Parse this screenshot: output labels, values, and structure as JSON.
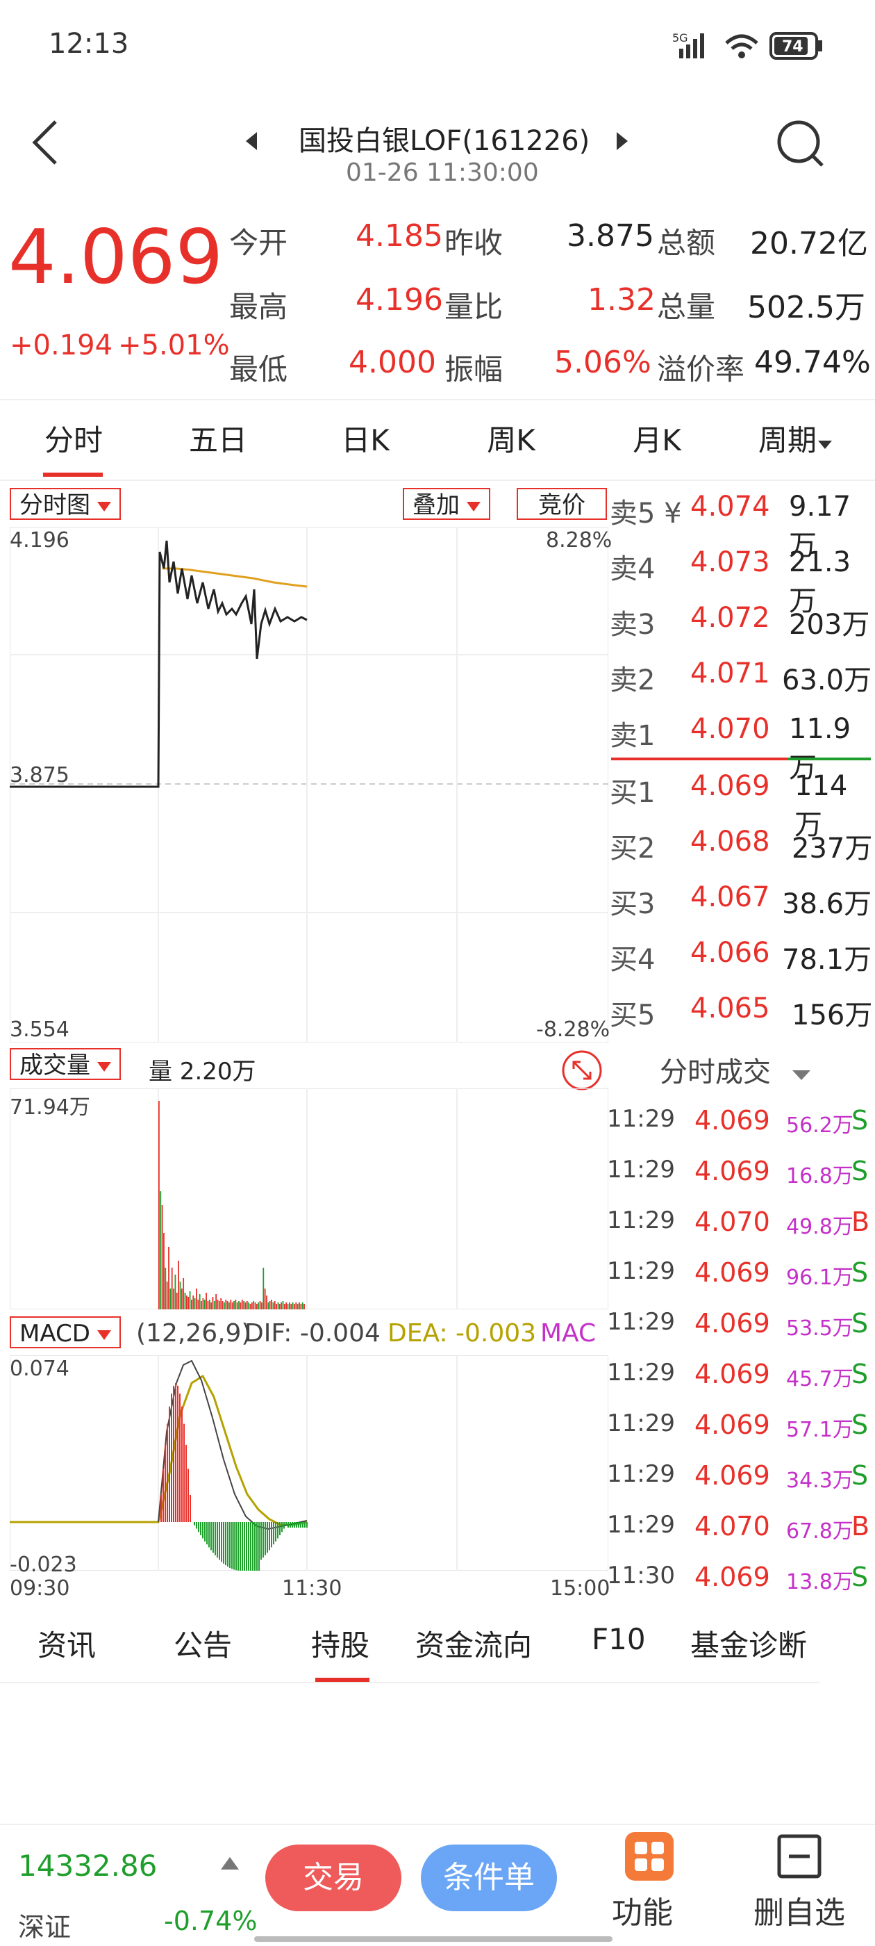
{
  "status": {
    "time": "12:13",
    "network": "5G",
    "battery": "74"
  },
  "header": {
    "title": "国投白银LOF(161226)",
    "subtitle": "01-26 11:30:00"
  },
  "quote": {
    "price": "4.069",
    "change": "+0.194",
    "change_pct": "+5.01%",
    "stats": [
      {
        "label": "今开",
        "value": "4.185"
      },
      {
        "label": "昨收",
        "value": "3.875"
      },
      {
        "label": "总额",
        "value": "20.72亿"
      },
      {
        "label": "最高",
        "value": "4.196"
      },
      {
        "label": "量比",
        "value": "1.32"
      },
      {
        "label": "总量",
        "value": "502.5万"
      },
      {
        "label": "最低",
        "value": "4.000"
      },
      {
        "label": "振幅",
        "value": "5.06%"
      },
      {
        "label": "溢价率",
        "value": "49.74%"
      }
    ]
  },
  "tabs": [
    "分时",
    "五日",
    "日K",
    "周K",
    "月K",
    "周期"
  ],
  "chart": {
    "selector": "分时图",
    "overlay": "叠加",
    "auction": "竞价",
    "y_top": "4.196",
    "y_mid": "3.875",
    "y_bot": "3.554",
    "pct_top": "8.28%",
    "pct_bot": "-8.28%",
    "volume_label": "成交量",
    "volume_value": "量 2.20万",
    "volume_max": "71.94万",
    "macd_label": "MACD",
    "macd_params": "(12,26,9)",
    "macd_dif": "DIF: -0.004",
    "macd_dea": "DEA: -0.003",
    "macd_mac": "MAC",
    "macd_top": "0.074",
    "macd_bot": "-0.023",
    "time_start": "09:30",
    "time_mid": "11:30",
    "time_end": "15:00"
  },
  "orderbook": {
    "asks": [
      {
        "label": "卖5 ¥",
        "price": "4.074",
        "vol": "9.17万"
      },
      {
        "label": "卖4",
        "price": "4.073",
        "vol": "21.3万"
      },
      {
        "label": "卖3",
        "price": "4.072",
        "vol": "203万"
      },
      {
        "label": "卖2",
        "price": "4.071",
        "vol": "63.0万"
      },
      {
        "label": "卖1",
        "price": "4.070",
        "vol": "11.9万"
      }
    ],
    "bids": [
      {
        "label": "买1",
        "price": "4.069",
        "vol": "114万"
      },
      {
        "label": "买2",
        "price": "4.068",
        "vol": "237万"
      },
      {
        "label": "买3",
        "price": "4.067",
        "vol": "38.6万"
      },
      {
        "label": "买4",
        "price": "4.066",
        "vol": "78.1万"
      },
      {
        "label": "买5",
        "price": "4.065",
        "vol": "156万"
      }
    ],
    "trades_title": "分时成交",
    "trades": [
      {
        "time": "11:29",
        "price": "4.069",
        "vol": "56.2万",
        "side": "S"
      },
      {
        "time": "11:29",
        "price": "4.069",
        "vol": "16.8万",
        "side": "S"
      },
      {
        "time": "11:29",
        "price": "4.070",
        "vol": "49.8万",
        "side": "B"
      },
      {
        "time": "11:29",
        "price": "4.069",
        "vol": "96.1万",
        "side": "S"
      },
      {
        "time": "11:29",
        "price": "4.069",
        "vol": "53.5万",
        "side": "S"
      },
      {
        "time": "11:29",
        "price": "4.069",
        "vol": "45.7万",
        "side": "S"
      },
      {
        "time": "11:29",
        "price": "4.069",
        "vol": "57.1万",
        "side": "S"
      },
      {
        "time": "11:29",
        "price": "4.069",
        "vol": "34.3万",
        "side": "S"
      },
      {
        "time": "11:29",
        "price": "4.070",
        "vol": "67.8万",
        "side": "B"
      },
      {
        "time": "11:30",
        "price": "4.069",
        "vol": "13.8万",
        "side": "S"
      }
    ]
  },
  "bottom_tabs": [
    "资讯",
    "公告",
    "持股",
    "资金流向",
    "F10",
    "基金诊断"
  ],
  "footer": {
    "index_value": "14332.86",
    "index_name": "深证",
    "index_change": "-0.74%",
    "trade_btn": "交易",
    "cond_btn": "条件单",
    "func_label": "功能",
    "del_label": "删自选"
  },
  "colors": {
    "up": "#e8302a",
    "down": "#1f9e2c",
    "avg_line": "#e0a020"
  }
}
